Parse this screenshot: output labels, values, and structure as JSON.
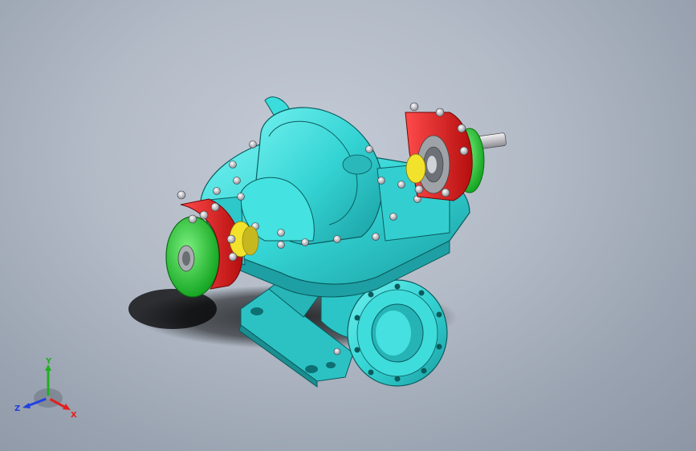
{
  "viewport": {
    "background_top": "#c4cbd6",
    "background_bottom": "#8d96a4"
  },
  "model": {
    "icon": "split-case-pump-3d-model",
    "colors": {
      "casing": "#35d4d4",
      "casing_shade": "#1fa3a6",
      "bearing_housing": "#e01c1c",
      "end_cover": "#2fd13a",
      "coupling_ring": "#f2e22c",
      "bolts": "#c8c8cc",
      "shaft": "#d9d9de"
    }
  },
  "triad": {
    "icon": "coordinate-triad-icon",
    "x_label": "X",
    "y_label": "Y",
    "z_label": "Z",
    "x_color": "#e02020",
    "y_color": "#20b020",
    "z_color": "#2040e0"
  }
}
